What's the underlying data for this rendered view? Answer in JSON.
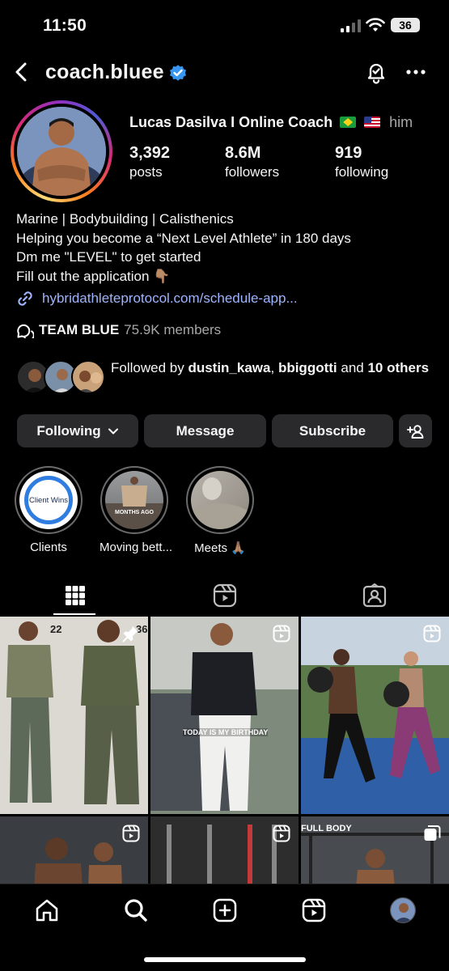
{
  "status_bar": {
    "time": "11:50",
    "battery": "36"
  },
  "header": {
    "username": "coach.bluee"
  },
  "profile": {
    "display_name": "Lucas Dasilva I Online Coach",
    "pronoun": "him",
    "stats": [
      {
        "value": "3,392",
        "label": "posts"
      },
      {
        "value": "8.6M",
        "label": "followers"
      },
      {
        "value": "919",
        "label": "following"
      }
    ],
    "bio": [
      "Marine | Bodybuilding | Calisthenics",
      "Helping you become a “Next Level Athlete” in 180 days",
      "Dm me \"LEVEL\" to get started",
      "Fill out the application 👇🏽"
    ],
    "link": "hybridathleteprotocol.com/schedule-app...",
    "channel": {
      "name": "TEAM BLUE",
      "members": "75.9K members"
    },
    "followed_by": {
      "prefix": "Followed by ",
      "user1": "dustin_kawa",
      "sep": ", ",
      "user2": "bbiggotti",
      "and": " and ",
      "others": "10 others"
    }
  },
  "buttons": {
    "following": "Following",
    "message": "Message",
    "subscribe": "Subscribe"
  },
  "highlights": [
    {
      "label": "Clients",
      "cover_text": "Client Wins"
    },
    {
      "label": "Moving bett...",
      "cover_text": "MONTHS AGO"
    },
    {
      "label": "Meets 🙏🏽",
      "cover_text": ""
    }
  ],
  "grid": {
    "posts": [
      {
        "overlay_left": "22",
        "overlay_right": "36"
      },
      {
        "caption": "TODAY IS MY BIRTHDAY"
      },
      {},
      {},
      {},
      {
        "caption": "FULL BODY"
      }
    ]
  },
  "colors": {
    "link": "#9fb4ff",
    "button_bg": "#2a2a2d",
    "verified": "#3797f0"
  }
}
